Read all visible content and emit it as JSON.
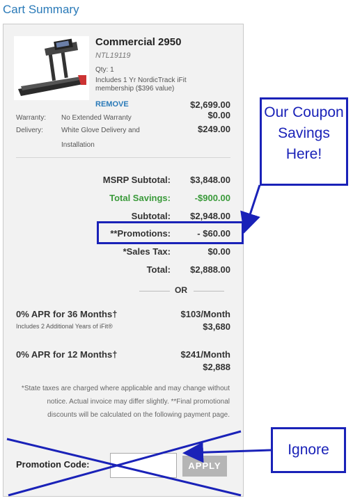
{
  "page": {
    "title": "Cart Summary"
  },
  "product": {
    "name": "Commercial 2950",
    "sku": "NTL19119",
    "qty": "Qty: 1",
    "note": "Includes 1 Yr NordicTrack iFit membership ($396 value)",
    "remove_label": "REMOVE",
    "price": "$2,699.00"
  },
  "details": {
    "warranty_label": "Warranty:",
    "warranty_value": "No Extended Warranty",
    "warranty_amount": "$0.00",
    "delivery_label": "Delivery:",
    "delivery_value": "White Glove Delivery and Installation",
    "delivery_amount": "$249.00"
  },
  "summary": [
    {
      "label": "MSRP Subtotal:",
      "amount": "$3,848.00",
      "highlight": false
    },
    {
      "label": "Total Savings:",
      "amount": "-$900.00",
      "highlight": true
    },
    {
      "label": "Subtotal:",
      "amount": "$2,948.00",
      "highlight": false
    },
    {
      "label": "**Promotions:",
      "amount": "- $60.00",
      "highlight": false
    },
    {
      "label": "*Sales Tax:",
      "amount": "$0.00",
      "highlight": false
    },
    {
      "label": "Total:",
      "amount": "$2,888.00",
      "highlight": false
    }
  ],
  "or_text": "OR",
  "financing": [
    {
      "title": "0% APR for 36 Months†",
      "sub": "Includes 2 Additional Years of iFit®",
      "monthly": "$103/Month",
      "total": "$3,680"
    },
    {
      "title": "0% APR for 12 Months†",
      "sub": "",
      "monthly": "$241/Month",
      "total": "$2,888"
    }
  ],
  "disclaimer": "*State taxes are charged where applicable and may change without notice. Actual invoice may differ slightly. **Final promotional discounts will be calculated on the following payment page.",
  "promo": {
    "label": "Promotion Code:",
    "input_value": "",
    "input_placeholder": "",
    "apply_label": "APPLY"
  },
  "annotations": {
    "callout_savings": "Our Coupon Savings Here!",
    "callout_ignore": "Ignore",
    "color": "#1a22b8"
  },
  "colors": {
    "link": "#2a7ab8",
    "savings_green": "#3a9a3a",
    "apply_button": "#b5b5b5"
  }
}
